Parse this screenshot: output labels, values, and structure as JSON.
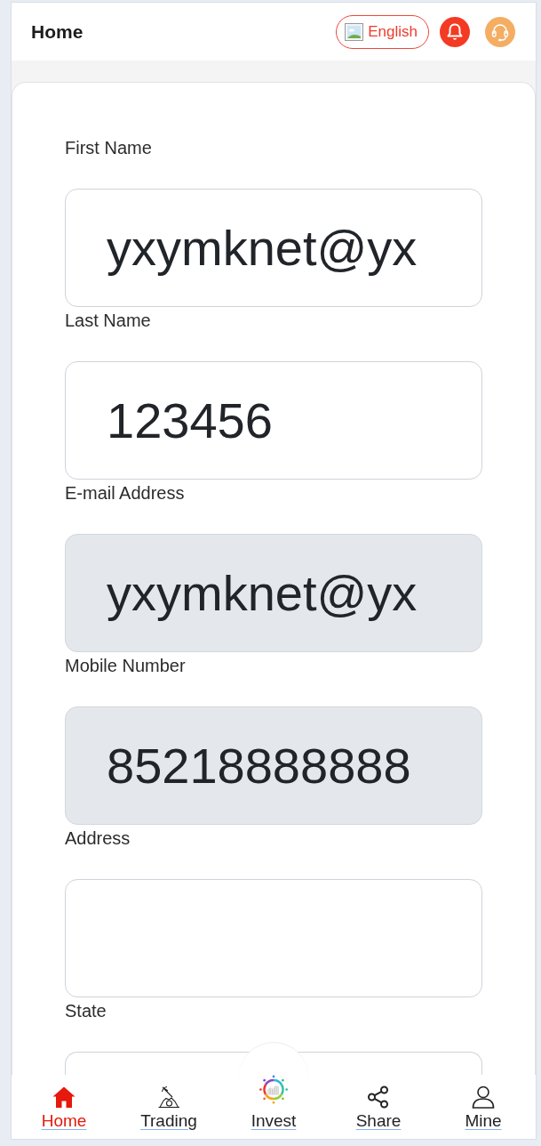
{
  "header": {
    "title": "Home",
    "language": "English"
  },
  "form": {
    "fields": [
      {
        "label": "First Name",
        "value": "yxymknet@yx",
        "disabled": false
      },
      {
        "label": "Last Name",
        "value": "123456",
        "disabled": false
      },
      {
        "label": "E-mail Address",
        "value": "yxymknet@yx",
        "disabled": true
      },
      {
        "label": "Mobile Number",
        "value": "85218888888",
        "disabled": true
      },
      {
        "label": "Address",
        "disabled": false
      },
      {
        "label": "State",
        "disabled": false
      }
    ]
  },
  "nav": {
    "items": [
      {
        "label": "Home",
        "kind": "home",
        "selected": true
      },
      {
        "label": "Trading",
        "kind": "trading",
        "selected": false
      },
      {
        "label": "Invest",
        "kind": "invest",
        "selected": false
      },
      {
        "label": "Share",
        "kind": "share",
        "selected": false
      },
      {
        "label": "Mine",
        "kind": "mine",
        "selected": false
      }
    ]
  }
}
